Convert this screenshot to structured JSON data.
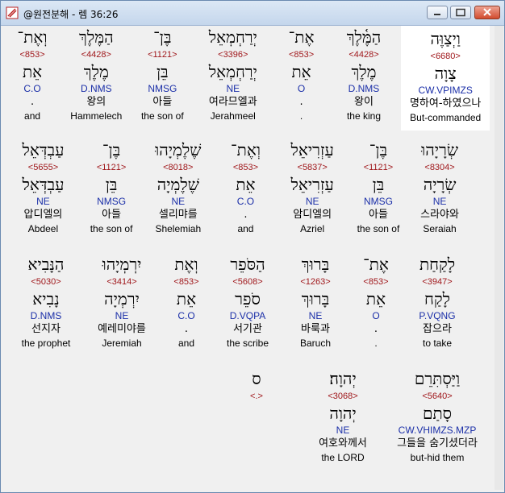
{
  "window": {
    "title": "@원전분해 - 렘 36:26"
  },
  "rows": [
    [
      {
        "heb": "וַיְצַוֶּה",
        "strong": "<6680>",
        "lex": "צָוָה",
        "morph": "CW.VPIMZS",
        "kor": "명하여-하였으나",
        "eng": "But-commanded",
        "selected": true
      },
      {
        "heb": "הַמֶּ֫לֶךְ",
        "strong": "<4428>",
        "lex": "מֶלֶךְ",
        "morph": "D.NMS",
        "kor": "왕이",
        "eng": "the king"
      },
      {
        "heb": "אֶת־",
        "strong": "<853>",
        "lex": "אֵת",
        "morph": "O",
        "kor": ".",
        "eng": "."
      },
      {
        "heb": "יְרַחְמְאֵל",
        "strong": "<3396>",
        "lex": "יְרַחְמְאֵל",
        "morph": "NE",
        "kor": "여라므엘과",
        "eng": "Jerahmeel"
      },
      {
        "heb": "בֶּן־",
        "strong": "<1121>",
        "lex": "בֵּן",
        "morph": "NMSG",
        "kor": "아들",
        "eng": "the son of"
      },
      {
        "heb": "הַמֶּלֶךְ",
        "strong": "<4428>",
        "lex": "מֶלֶךְ",
        "morph": "D.NMS",
        "kor": "왕의",
        "eng": "Hammelech"
      },
      {
        "heb": "וְאֶת־",
        "strong": "<853>",
        "lex": "אֵת",
        "morph": "C.O",
        "kor": ".",
        "eng": "and"
      }
    ],
    [
      {
        "heb": "שְׂרָיָהוּ",
        "strong": "<8304>",
        "lex": "שְׂרָיָה",
        "morph": "NE",
        "kor": "스라야와",
        "eng": "Seraiah"
      },
      {
        "heb": "בֶּן־",
        "strong": "<1121>",
        "lex": "בֵּן",
        "morph": "NMSG",
        "kor": "아들",
        "eng": "the son of"
      },
      {
        "heb": "עַזְרִיאֵל",
        "strong": "<5837>",
        "lex": "עַזְרִיאֵל",
        "morph": "NE",
        "kor": "암디엘의",
        "eng": "Azriel"
      },
      {
        "heb": "וְאֶת־",
        "strong": "<853>",
        "lex": "אֵת",
        "morph": "C.O",
        "kor": ".",
        "eng": "and"
      },
      {
        "heb": "שֶׁלֶמְיָהוּ",
        "strong": "<8018>",
        "lex": "שֶׁלֶמְיָה",
        "morph": "NE",
        "kor": "셀리먀를",
        "eng": "Shelemiah"
      },
      {
        "heb": "בֶּן־",
        "strong": "<1121>",
        "lex": "בֵּן",
        "morph": "NMSG",
        "kor": "아들",
        "eng": "the son of"
      },
      {
        "heb": "עַבְדְּאֵל",
        "strong": "<5655>",
        "lex": "עַבְדְּאֵל",
        "morph": "NE",
        "kor": "압디엘의",
        "eng": "Abdeel"
      }
    ],
    [
      {
        "heb": "לָקַחַת",
        "strong": "<3947>",
        "lex": "לָקַח",
        "morph": "P.VQNG",
        "kor": "잡으라",
        "eng": "to take"
      },
      {
        "heb": "אֶת־",
        "strong": "<853>",
        "lex": "אֵת",
        "morph": "O",
        "kor": ".",
        "eng": "."
      },
      {
        "heb": "בָּרוּךְ",
        "strong": "<1263>",
        "lex": "בָּרוּךְ",
        "morph": "NE",
        "kor": "바룩과",
        "eng": "Baruch"
      },
      {
        "heb": "הַסֹּפֵר",
        "strong": "<5608>",
        "lex": "סֹפֵר",
        "morph": "D.VQPA",
        "kor": "서기관",
        "eng": "the scribe"
      },
      {
        "heb": "וְאֶת",
        "strong": "<853>",
        "lex": "אֵת",
        "morph": "C.O",
        "kor": ".",
        "eng": "and"
      },
      {
        "heb": "יִרְמְיָהוּ",
        "strong": "<3414>",
        "lex": "יִרְמְיָה",
        "morph": "NE",
        "kor": "예레미야를",
        "eng": "Jeremiah"
      },
      {
        "heb": "הַנָּבִיא",
        "strong": "<5030>",
        "lex": "נָבִיא",
        "morph": "D.NMS",
        "kor": "선지자",
        "eng": "the prophet"
      }
    ],
    [
      {
        "heb": "וַיַּסְתִּרֵם",
        "strong": "<5640>",
        "lex": "סָתַם",
        "morph": "CW.VHIMZS.MZP",
        "kor": "그들을 숨기셨더라",
        "eng": "but-hid them"
      },
      {
        "heb": "יְהוָה׃",
        "strong": "<3068>",
        "lex": "יְהוָה",
        "morph": "NE",
        "kor": "여호와께서",
        "eng": "the LORD"
      },
      {
        "heb": "ס",
        "strong": "<.>",
        "lex": "",
        "morph": "",
        "kor": "",
        "eng": ""
      }
    ]
  ]
}
